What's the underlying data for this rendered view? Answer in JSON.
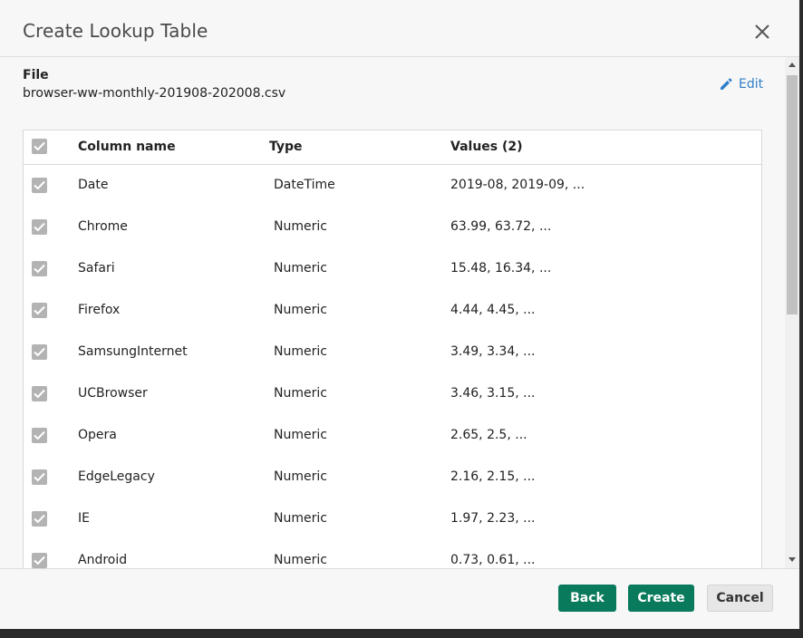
{
  "dialog": {
    "title": "Create Lookup Table",
    "close_icon": "close-icon"
  },
  "file": {
    "label": "File",
    "name": "browser-ww-monthly-201908-202008.csv",
    "edit_label": "Edit",
    "edit_icon": "pencil-icon"
  },
  "table": {
    "headers": {
      "column_name": "Column name",
      "type": "Type",
      "values": "Values (2)"
    },
    "rows": [
      {
        "name": "Date",
        "type": "DateTime",
        "values": "2019-08, 2019-09, ...",
        "checked": true
      },
      {
        "name": "Chrome",
        "type": "Numeric",
        "values": "63.99, 63.72, ...",
        "checked": true
      },
      {
        "name": "Safari",
        "type": "Numeric",
        "values": "15.48, 16.34, ...",
        "checked": true
      },
      {
        "name": "Firefox",
        "type": "Numeric",
        "values": "4.44, 4.45, ...",
        "checked": true
      },
      {
        "name": "SamsungInternet",
        "type": "Numeric",
        "values": "3.49, 3.34, ...",
        "checked": true
      },
      {
        "name": "UCBrowser",
        "type": "Numeric",
        "values": "3.46, 3.15, ...",
        "checked": true
      },
      {
        "name": "Opera",
        "type": "Numeric",
        "values": "2.65, 2.5, ...",
        "checked": true
      },
      {
        "name": "EdgeLegacy",
        "type": "Numeric",
        "values": "2.16, 2.15, ...",
        "checked": true
      },
      {
        "name": "IE",
        "type": "Numeric",
        "values": "1.97, 2.23, ...",
        "checked": true
      },
      {
        "name": "Android",
        "type": "Numeric",
        "values": "0.73, 0.61, ...",
        "checked": true
      }
    ]
  },
  "footer": {
    "back_label": "Back",
    "create_label": "Create",
    "cancel_label": "Cancel"
  },
  "colors": {
    "primary": "#0a7a5c",
    "link": "#2f7fc8",
    "checkbox": "#b3b3b3"
  }
}
